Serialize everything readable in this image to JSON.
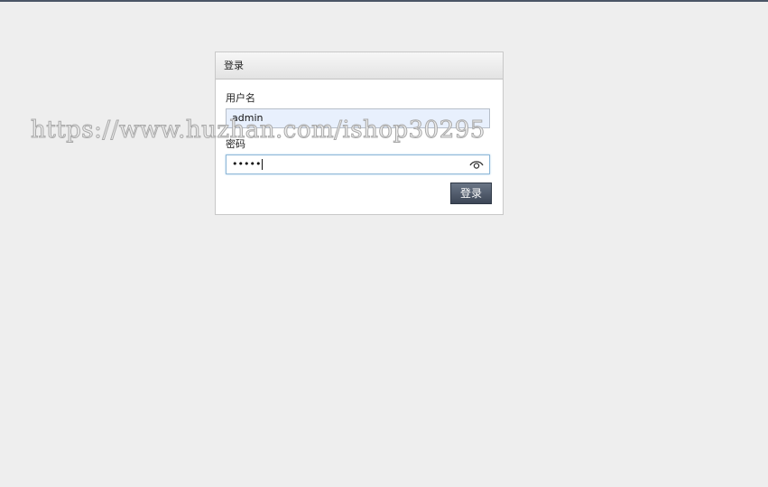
{
  "watermark": "https://www.huzhan.com/ishop30295",
  "login_panel": {
    "title": "登录",
    "username": {
      "label": "用户名",
      "value": "admin"
    },
    "password": {
      "label": "密码",
      "masked_value": "•••••"
    },
    "submit_label": "登录",
    "icons": {
      "password_toggle": "eye-icon"
    }
  },
  "colors": {
    "background": "#eeeeee",
    "button": "#4a5566",
    "username_field": "#e8f0fd",
    "focus_border": "#8fb8d8"
  }
}
